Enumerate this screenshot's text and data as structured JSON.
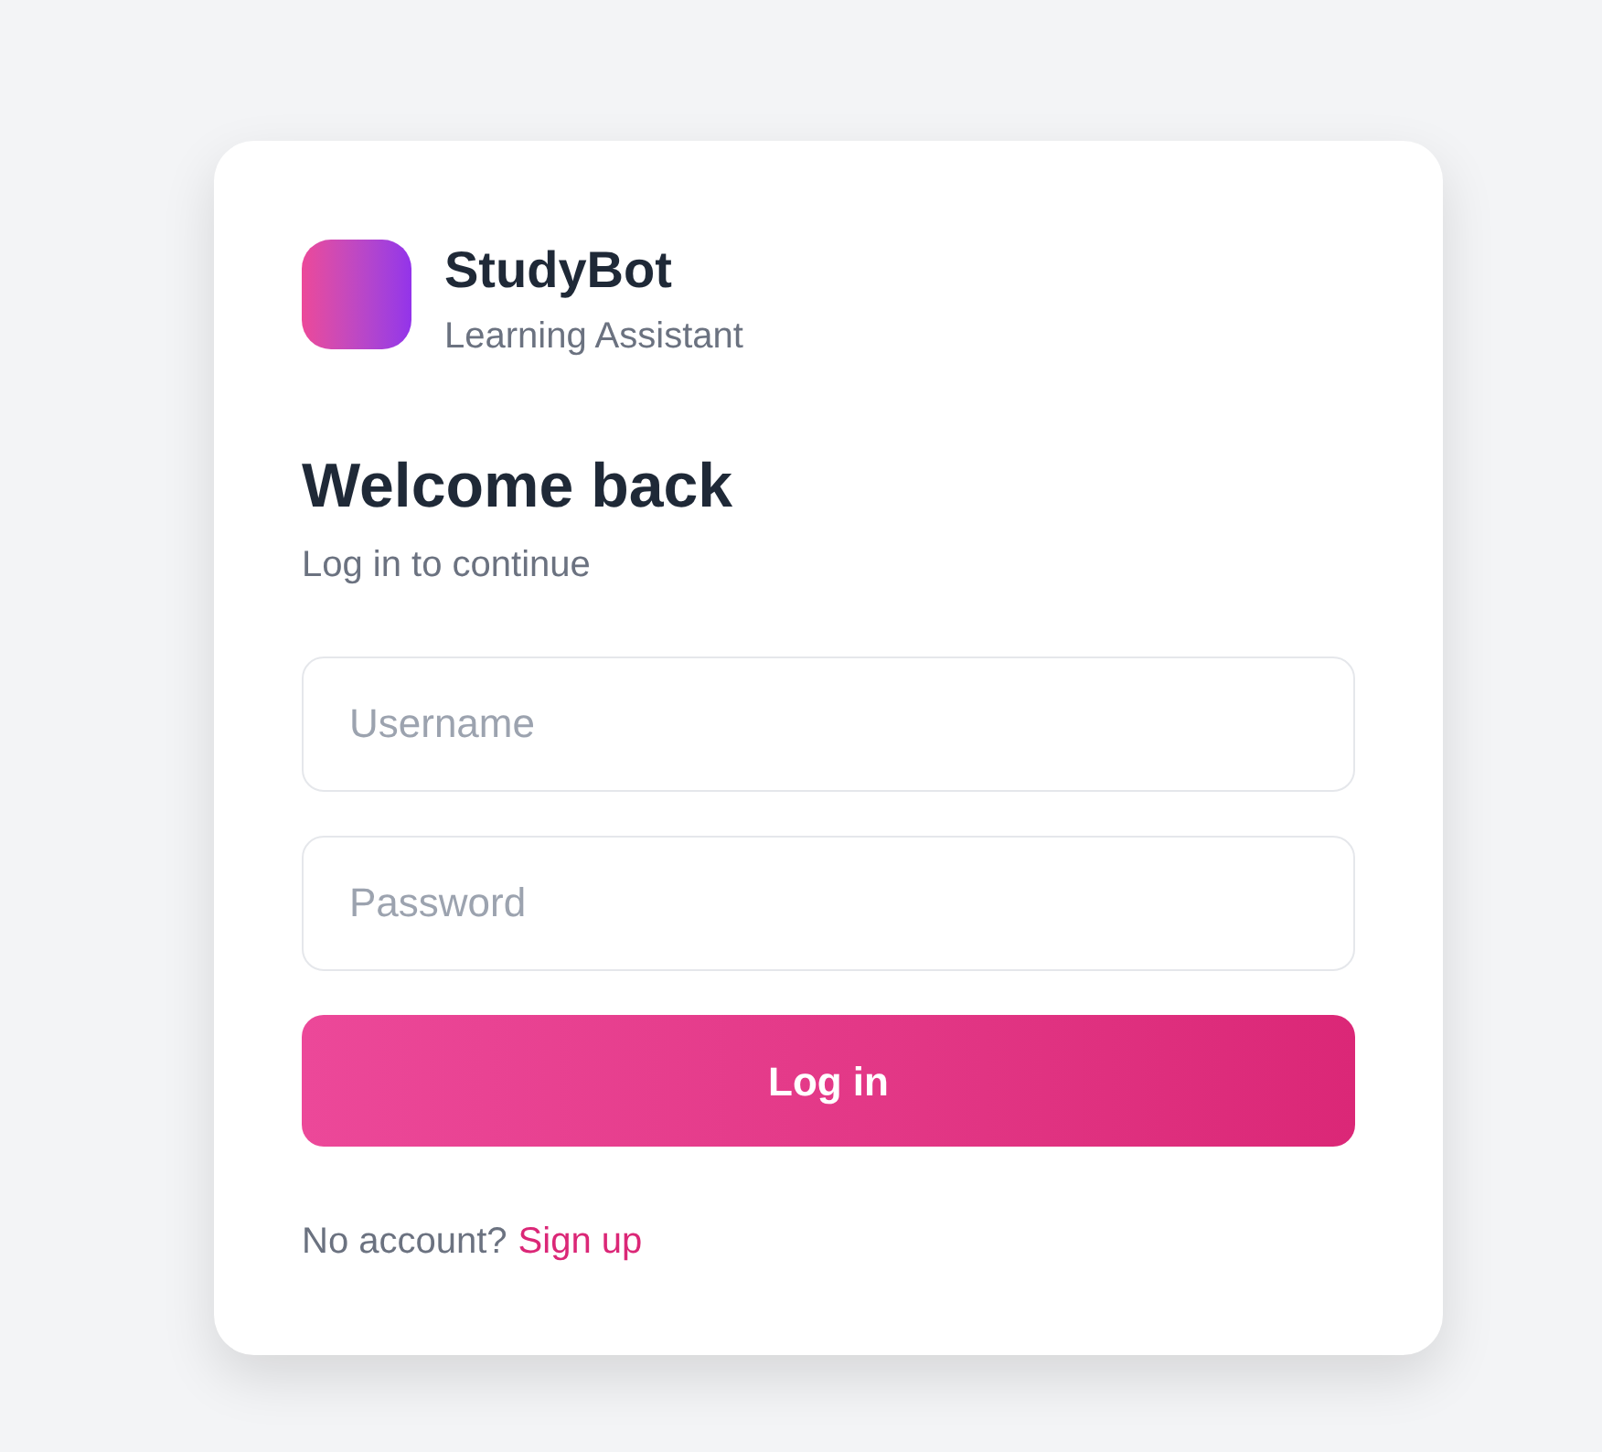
{
  "brand": {
    "name": "StudyBot",
    "subtitle": "Learning Assistant"
  },
  "heading": "Welcome back",
  "subheading": "Log in to continue",
  "fields": [
    {
      "placeholder": "Username"
    },
    {
      "placeholder": "Password"
    }
  ],
  "submit_button": {
    "label": "Log in"
  },
  "footer": {
    "prompt": "No account?",
    "link": "Sign up"
  }
}
